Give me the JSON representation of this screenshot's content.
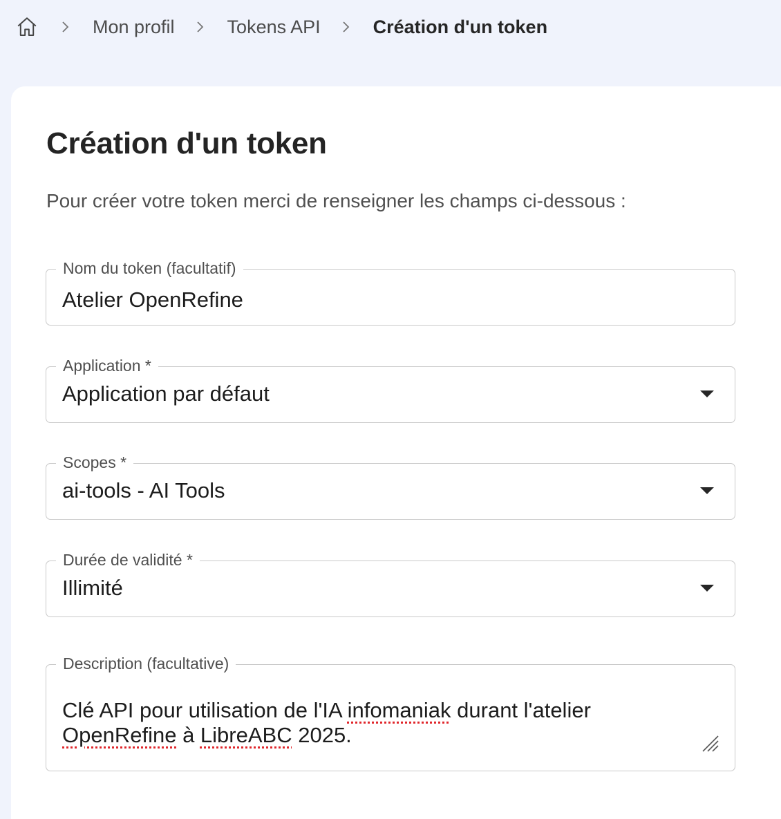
{
  "breadcrumb": {
    "home_icon": "home-icon",
    "items": [
      "Mon profil",
      "Tokens API",
      "Création d'un token"
    ]
  },
  "page": {
    "title": "Création d'un token",
    "subtitle": "Pour créer votre token merci de renseigner les champs ci-dessous :"
  },
  "form": {
    "name": {
      "label": "Nom du token (facultatif)",
      "value": "Atelier OpenRefine"
    },
    "application": {
      "label": "Application *",
      "value": "Application par défaut"
    },
    "scopes": {
      "label": "Scopes *",
      "value": "ai-tools - AI Tools"
    },
    "validity": {
      "label": "Durée de validité *",
      "value": "Illimité"
    },
    "description": {
      "label": "Description (facultative)",
      "parts": [
        "Clé API pour utilisation de l'IA ",
        "infomaniak",
        " durant l'atelier ",
        "OpenRefine",
        " à ",
        "LibreABC",
        " 2025."
      ]
    }
  },
  "colors": {
    "page_bg": "#f0f3fc",
    "card_bg": "#ffffff",
    "border": "#c9c9c9",
    "spellcheck": "#e0262b"
  }
}
